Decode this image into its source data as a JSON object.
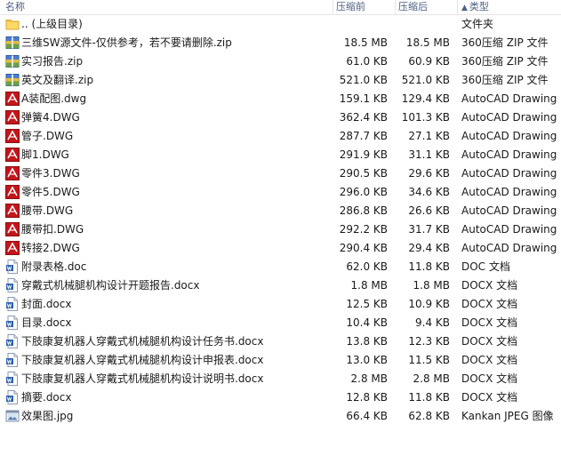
{
  "columns": {
    "name": "名称",
    "compressed": "压缩前",
    "original": "压缩后",
    "type": "类型",
    "sort_indicator": "▲"
  },
  "rows": [
    {
      "name": ".. (上级目录)",
      "compressed": "",
      "original": "",
      "type": "文件夹",
      "icon": "folder-icon"
    },
    {
      "name": "三维SW源文件-仅供参考，若不要请删除.zip",
      "compressed": "18.5 MB",
      "original": "18.5 MB",
      "type": "360压缩 ZIP 文件",
      "icon": "zip-archive-icon"
    },
    {
      "name": "实习报告.zip",
      "compressed": "61.0 KB",
      "original": "60.9 KB",
      "type": "360压缩 ZIP 文件",
      "icon": "zip-archive-icon"
    },
    {
      "name": "英文及翻译.zip",
      "compressed": "521.0 KB",
      "original": "521.0 KB",
      "type": "360压缩 ZIP 文件",
      "icon": "zip-archive-icon"
    },
    {
      "name": "A装配图.dwg",
      "compressed": "159.1 KB",
      "original": "129.4 KB",
      "type": "AutoCAD Drawing",
      "icon": "autocad-icon"
    },
    {
      "name": "弹簧4.DWG",
      "compressed": "362.4 KB",
      "original": "101.3 KB",
      "type": "AutoCAD Drawing",
      "icon": "autocad-icon"
    },
    {
      "name": "管子.DWG",
      "compressed": "287.7 KB",
      "original": "27.1 KB",
      "type": "AutoCAD Drawing",
      "icon": "autocad-icon"
    },
    {
      "name": "脚1.DWG",
      "compressed": "291.9 KB",
      "original": "31.1 KB",
      "type": "AutoCAD Drawing",
      "icon": "autocad-icon"
    },
    {
      "name": "零件3.DWG",
      "compressed": "290.5 KB",
      "original": "29.6 KB",
      "type": "AutoCAD Drawing",
      "icon": "autocad-icon"
    },
    {
      "name": "零件5.DWG",
      "compressed": "296.0 KB",
      "original": "34.6 KB",
      "type": "AutoCAD Drawing",
      "icon": "autocad-icon"
    },
    {
      "name": "腰带.DWG",
      "compressed": "286.8 KB",
      "original": "26.6 KB",
      "type": "AutoCAD Drawing",
      "icon": "autocad-icon"
    },
    {
      "name": "腰带扣.DWG",
      "compressed": "292.2 KB",
      "original": "31.7 KB",
      "type": "AutoCAD Drawing",
      "icon": "autocad-icon"
    },
    {
      "name": "转接2.DWG",
      "compressed": "290.4 KB",
      "original": "29.4 KB",
      "type": "AutoCAD Drawing",
      "icon": "autocad-icon"
    },
    {
      "name": "附录表格.doc",
      "compressed": "62.0 KB",
      "original": "11.8 KB",
      "type": "DOC 文档",
      "icon": "word-doc-icon"
    },
    {
      "name": "穿戴式机械腿机构设计开题报告.docx",
      "compressed": "1.8 MB",
      "original": "1.8 MB",
      "type": "DOCX 文档",
      "icon": "word-doc-icon"
    },
    {
      "name": "封面.docx",
      "compressed": "12.5 KB",
      "original": "10.9 KB",
      "type": "DOCX 文档",
      "icon": "word-doc-icon"
    },
    {
      "name": "目录.docx",
      "compressed": "10.4 KB",
      "original": "9.4 KB",
      "type": "DOCX 文档",
      "icon": "word-doc-icon"
    },
    {
      "name": "下肢康复机器人穿戴式机械腿机构设计任务书.docx",
      "compressed": "13.8 KB",
      "original": "12.3 KB",
      "type": "DOCX 文档",
      "icon": "word-doc-icon"
    },
    {
      "name": "下肢康复机器人穿戴式机械腿机构设计申报表.docx",
      "compressed": "13.0 KB",
      "original": "11.5 KB",
      "type": "DOCX 文档",
      "icon": "word-doc-icon"
    },
    {
      "name": "下肢康复机器人穿戴式机械腿机构设计说明书.docx",
      "compressed": "2.8 MB",
      "original": "2.8 MB",
      "type": "DOCX 文档",
      "icon": "word-doc-icon"
    },
    {
      "name": "摘要.docx",
      "compressed": "12.8 KB",
      "original": "11.8 KB",
      "type": "DOCX 文档",
      "icon": "word-doc-icon"
    },
    {
      "name": "效果图.jpg",
      "compressed": "66.4 KB",
      "original": "62.8 KB",
      "type": "Kankan JPEG 图像",
      "icon": "jpeg-image-icon"
    }
  ]
}
